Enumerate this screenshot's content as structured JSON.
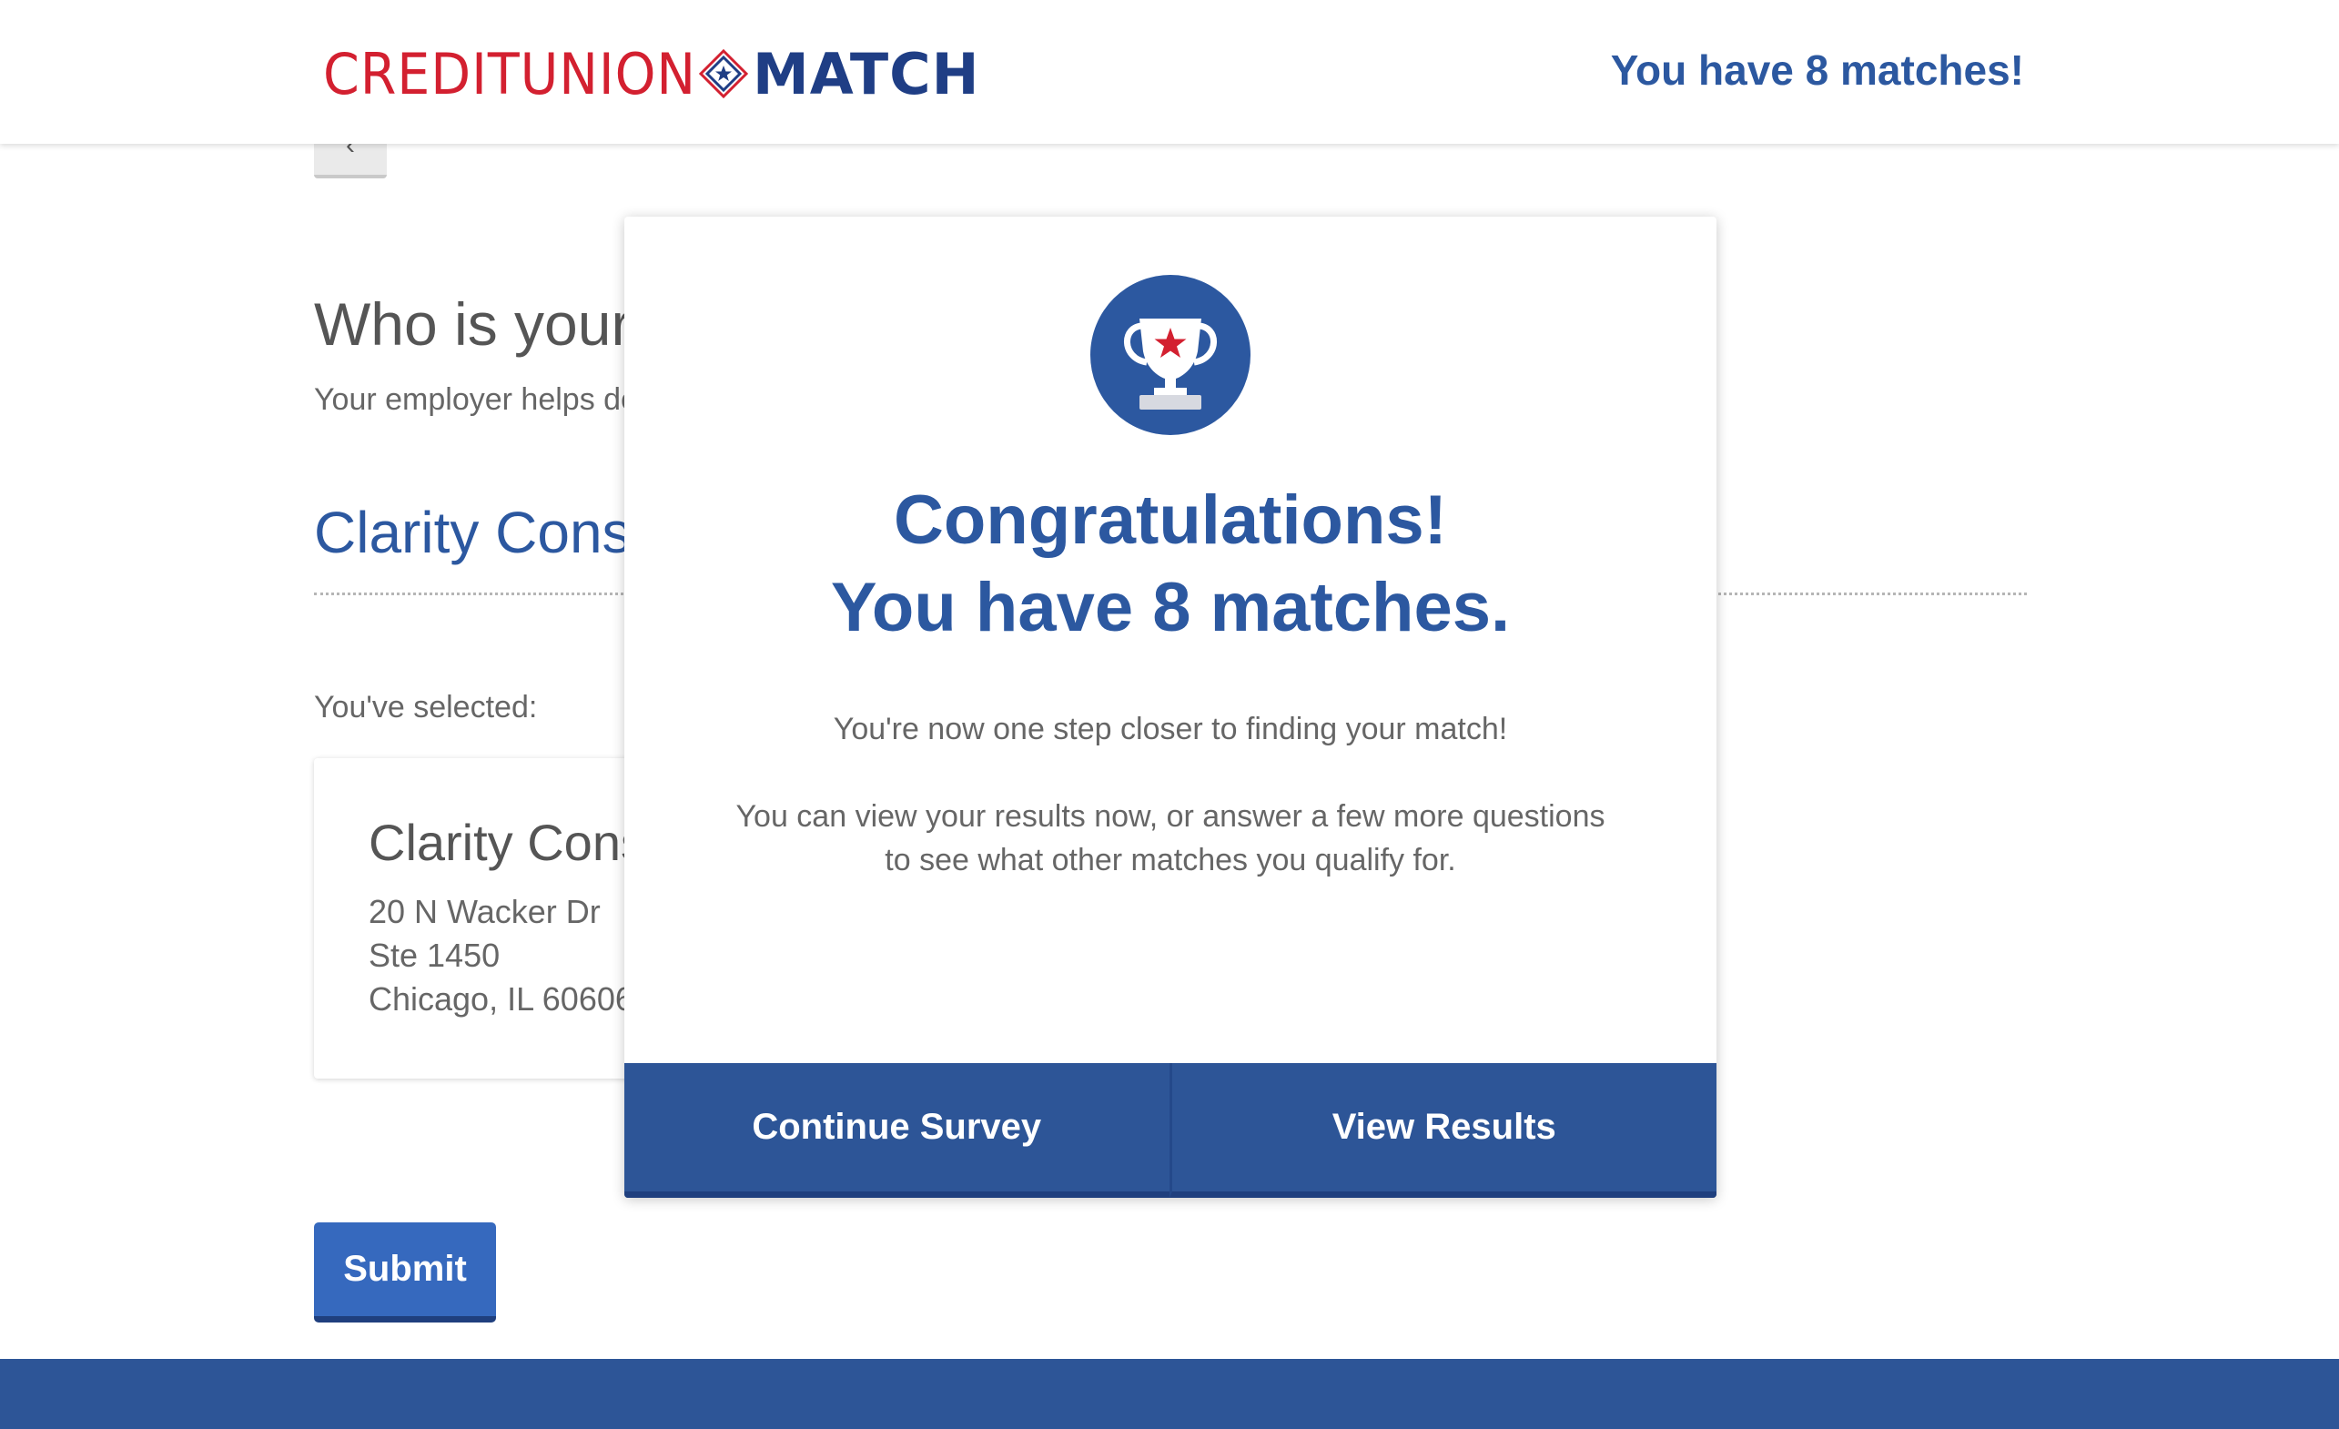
{
  "header": {
    "logo_part1": "CREDITUNION",
    "logo_part2": "MATCH",
    "matches_text": "You have 8 matches!"
  },
  "page": {
    "back_label": "‹",
    "question": "Who is your",
    "subtext": "Your employer helps de",
    "employer_input_value": "Clarity Cons",
    "selected_label": "You've selected:",
    "card": {
      "name": "Clarity Cons",
      "address_line1": "20 N Wacker Dr",
      "address_line2": "Ste 1450",
      "address_line3": "Chicago, IL  60606"
    },
    "submit_label": "Submit"
  },
  "modal": {
    "icon": "trophy-star-icon",
    "title_line1": "Congratulations!",
    "title_line2": "You have 8 matches.",
    "text_line1": "You're now one step closer to finding your match!",
    "text_line2": "You can view your results now, or answer a few more questions",
    "text_line3": "to see what other matches you qualify for.",
    "continue_label": "Continue Survey",
    "view_results_label": "View Results"
  },
  "colors": {
    "brand_red": "#d32030",
    "brand_navy": "#1f3e85",
    "primary_blue": "#2c58a0",
    "button_blue": "#3669be",
    "footer_blue": "#2d5597"
  }
}
